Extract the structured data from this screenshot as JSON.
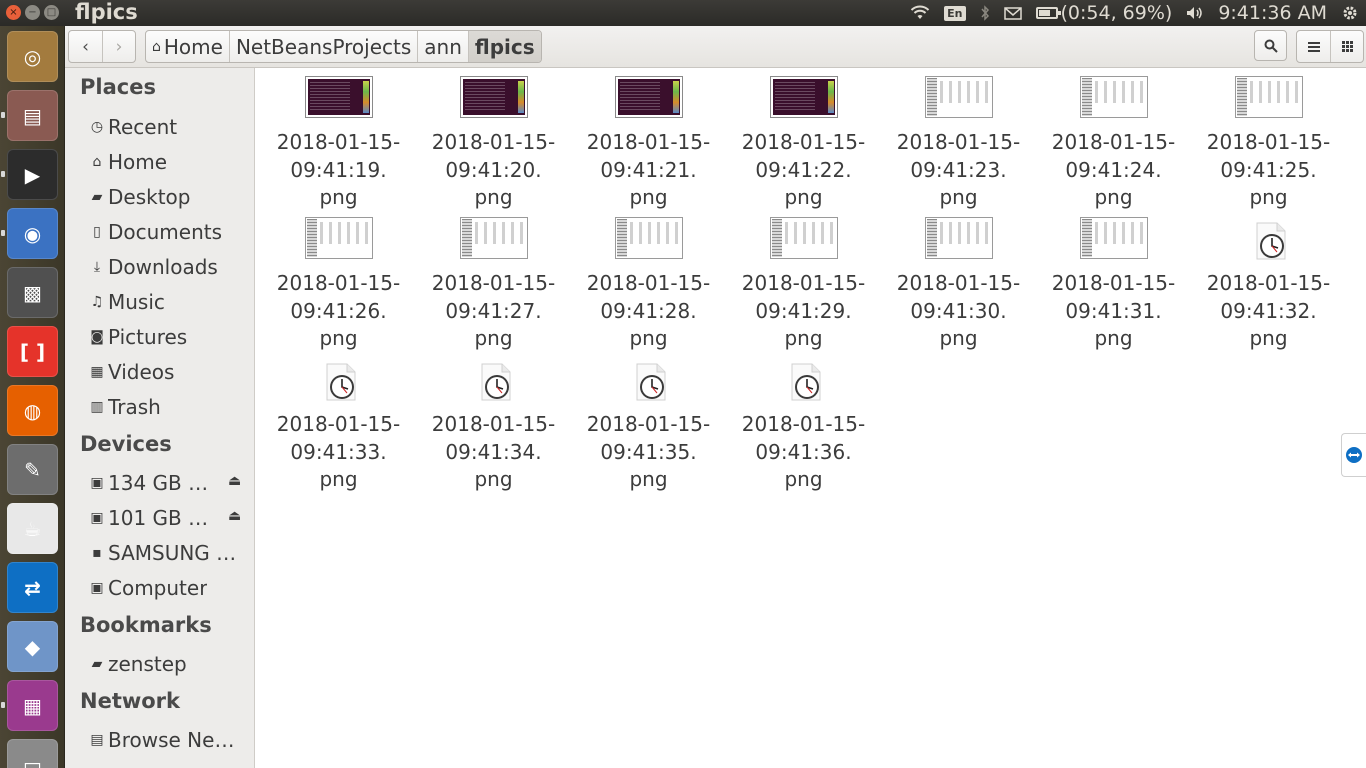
{
  "window": {
    "title": "flpics",
    "buttons": [
      "×",
      "−",
      "□"
    ]
  },
  "top_panel": {
    "keyboard_layout": "En",
    "battery_text": "(0:54, 69%)",
    "battery_percent": 69,
    "clock": "9:41:36 AM"
  },
  "launcher": {
    "items": [
      {
        "name": "ubuntu-dash-icon",
        "color": "#a37b3e"
      },
      {
        "name": "file-manager-icon",
        "color": "#8a5a52"
      },
      {
        "name": "terminal-icon",
        "color": "#2c2c2c"
      },
      {
        "name": "chromium-icon",
        "color": "#3b72c2"
      },
      {
        "name": "video-editor-icon",
        "color": "#505050"
      },
      {
        "name": "brackets-icon",
        "color": "#e5332a"
      },
      {
        "name": "firefox-icon",
        "color": "#e66000"
      },
      {
        "name": "text-editor-icon",
        "color": "#6d6d6d"
      },
      {
        "name": "java-icon",
        "color": "#e8e8e8"
      },
      {
        "name": "teamviewer-icon",
        "color": "#0e6fc4"
      },
      {
        "name": "virtualbox-icon",
        "color": "#6f95c8"
      },
      {
        "name": "workspace-switcher-icon",
        "color": "#9a3a8e"
      },
      {
        "name": "removable-drive-icon",
        "color": "#8a8a8a"
      }
    ]
  },
  "toolbar": {
    "back_glyph": "‹",
    "forward_glyph": "›",
    "breadcrumbs": [
      "Home",
      "NetBeansProjects",
      "ann",
      "flpics"
    ],
    "search_icon": "search-icon",
    "list_view_icon": "list-view-icon",
    "grid_view_icon": "grid-view-icon"
  },
  "sidebar": {
    "places_header": "Places",
    "places": [
      {
        "label": "Recent",
        "icon": "clock-icon"
      },
      {
        "label": "Home",
        "icon": "home-icon"
      },
      {
        "label": "Desktop",
        "icon": "folder-icon"
      },
      {
        "label": "Documents",
        "icon": "document-icon"
      },
      {
        "label": "Downloads",
        "icon": "download-icon"
      },
      {
        "label": "Music",
        "icon": "music-icon"
      },
      {
        "label": "Pictures",
        "icon": "camera-icon"
      },
      {
        "label": "Videos",
        "icon": "film-icon"
      },
      {
        "label": "Trash",
        "icon": "trash-icon"
      }
    ],
    "devices_header": "Devices",
    "devices": [
      {
        "label": "134 GB …",
        "icon": "drive-icon",
        "eject": true
      },
      {
        "label": "101 GB …",
        "icon": "drive-icon",
        "eject": true
      },
      {
        "label": "SAMSUNG …",
        "icon": "usb-drive-icon",
        "eject": false
      },
      {
        "label": "Computer",
        "icon": "drive-icon",
        "eject": false
      }
    ],
    "bookmarks_header": "Bookmarks",
    "bookmarks": [
      {
        "label": "zenstep",
        "icon": "folder-icon"
      }
    ],
    "network_header": "Network",
    "network": [
      {
        "label": "Browse Ne…",
        "icon": "network-icon"
      }
    ]
  },
  "files": [
    {
      "name": "2018-01-15-\n09:41:19.\npng",
      "thumb": "dark"
    },
    {
      "name": "2018-01-15-\n09:41:20.\npng",
      "thumb": "dark"
    },
    {
      "name": "2018-01-15-\n09:41:21.\npng",
      "thumb": "dark"
    },
    {
      "name": "2018-01-15-\n09:41:22.\npng",
      "thumb": "dark"
    },
    {
      "name": "2018-01-15-\n09:41:23.\npng",
      "thumb": "light"
    },
    {
      "name": "2018-01-15-\n09:41:24.\npng",
      "thumb": "light"
    },
    {
      "name": "2018-01-15-\n09:41:25.\npng",
      "thumb": "light"
    },
    {
      "name": "2018-01-15-\n09:41:26.\npng",
      "thumb": "light"
    },
    {
      "name": "2018-01-15-\n09:41:27.\npng",
      "thumb": "light"
    },
    {
      "name": "2018-01-15-\n09:41:28.\npng",
      "thumb": "light"
    },
    {
      "name": "2018-01-15-\n09:41:29.\npng",
      "thumb": "light"
    },
    {
      "name": "2018-01-15-\n09:41:30.\npng",
      "thumb": "light"
    },
    {
      "name": "2018-01-15-\n09:41:31.\npng",
      "thumb": "light"
    },
    {
      "name": "2018-01-15-\n09:41:32.\npng",
      "thumb": "pending"
    },
    {
      "name": "2018-01-15-\n09:41:33.\npng",
      "thumb": "pending"
    },
    {
      "name": "2018-01-15-\n09:41:34.\npng",
      "thumb": "pending"
    },
    {
      "name": "2018-01-15-\n09:41:35.\npng",
      "thumb": "pending"
    },
    {
      "name": "2018-01-15-\n09:41:36.\npng",
      "thumb": "pending"
    }
  ],
  "colors": {
    "panel_bg": "#3c3b37",
    "close_button": "#e9603a",
    "sidebar_bg": "#edecea",
    "launcher_bg": "#4b4534",
    "teamviewer_blue": "#0e6fc4"
  }
}
